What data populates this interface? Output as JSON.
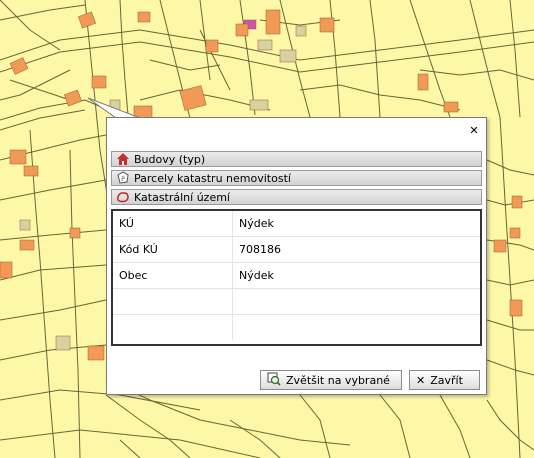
{
  "popup": {
    "close_icon": "close-icon",
    "sections": [
      {
        "label": "Budovy (typ)",
        "icon": "building-icon"
      },
      {
        "label": "Parcely katastru nemovitostí",
        "icon": "parcel-icon"
      },
      {
        "label": "Katastrální území",
        "icon": "territory-icon"
      }
    ],
    "table": {
      "rows": [
        {
          "key": "KÚ",
          "value": "Nýdek"
        },
        {
          "key": "Kód KÚ",
          "value": "708186"
        },
        {
          "key": "Obec",
          "value": "Nýdek"
        },
        {
          "key": "",
          "value": ""
        },
        {
          "key": "",
          "value": ""
        }
      ]
    },
    "buttons": {
      "zoom_label": "Zvětšit na vybrané",
      "close_label": "Zavřít"
    }
  },
  "colors": {
    "map_background": "#fdf7a8",
    "parcel_line": "#6b6434",
    "building": "#f09a55",
    "building_special": "#cc55aa",
    "building_grey": "#d7d3a0"
  }
}
